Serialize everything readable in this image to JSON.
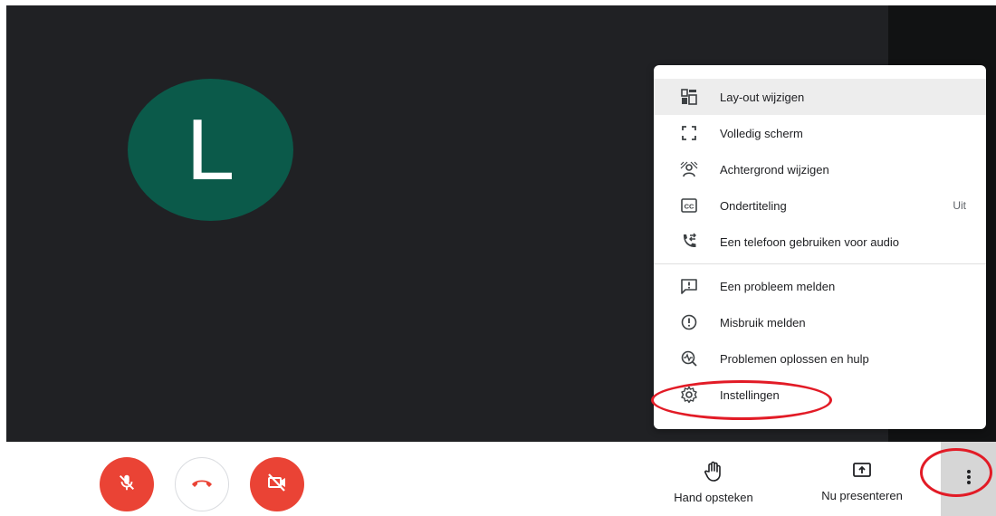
{
  "participant": {
    "initial": "L",
    "color": "#0b5a4a"
  },
  "controls": {
    "mic": {
      "icon": "mic-off-icon",
      "color": "#ea4335"
    },
    "hangup": {
      "icon": "phone-hangup-icon",
      "color": "#ea4335"
    },
    "camera": {
      "icon": "camera-off-icon",
      "color": "#ea4335"
    }
  },
  "actions": {
    "raise_hand": {
      "label": "Hand opsteken",
      "icon": "hand-icon"
    },
    "present": {
      "label": "Nu presenteren",
      "icon": "present-icon"
    },
    "more": {
      "icon": "more-vert-icon"
    }
  },
  "menu": {
    "items": [
      {
        "label": "Lay-out wijzigen",
        "icon": "layout-icon"
      },
      {
        "label": "Volledig scherm",
        "icon": "fullscreen-icon"
      },
      {
        "label": "Achtergrond wijzigen",
        "icon": "background-icon"
      },
      {
        "label": "Ondertiteling",
        "icon": "captions-icon",
        "value": "Uit"
      },
      {
        "label": "Een telefoon gebruiken voor audio",
        "icon": "phone-audio-icon"
      },
      {
        "label": "Een probleem melden",
        "icon": "report-problem-icon"
      },
      {
        "label": "Misbruik melden",
        "icon": "report-abuse-icon"
      },
      {
        "label": "Problemen oplossen en hulp",
        "icon": "troubleshoot-icon"
      },
      {
        "label": "Instellingen",
        "icon": "gear-icon"
      }
    ]
  },
  "annotation_color": "#e21b26"
}
